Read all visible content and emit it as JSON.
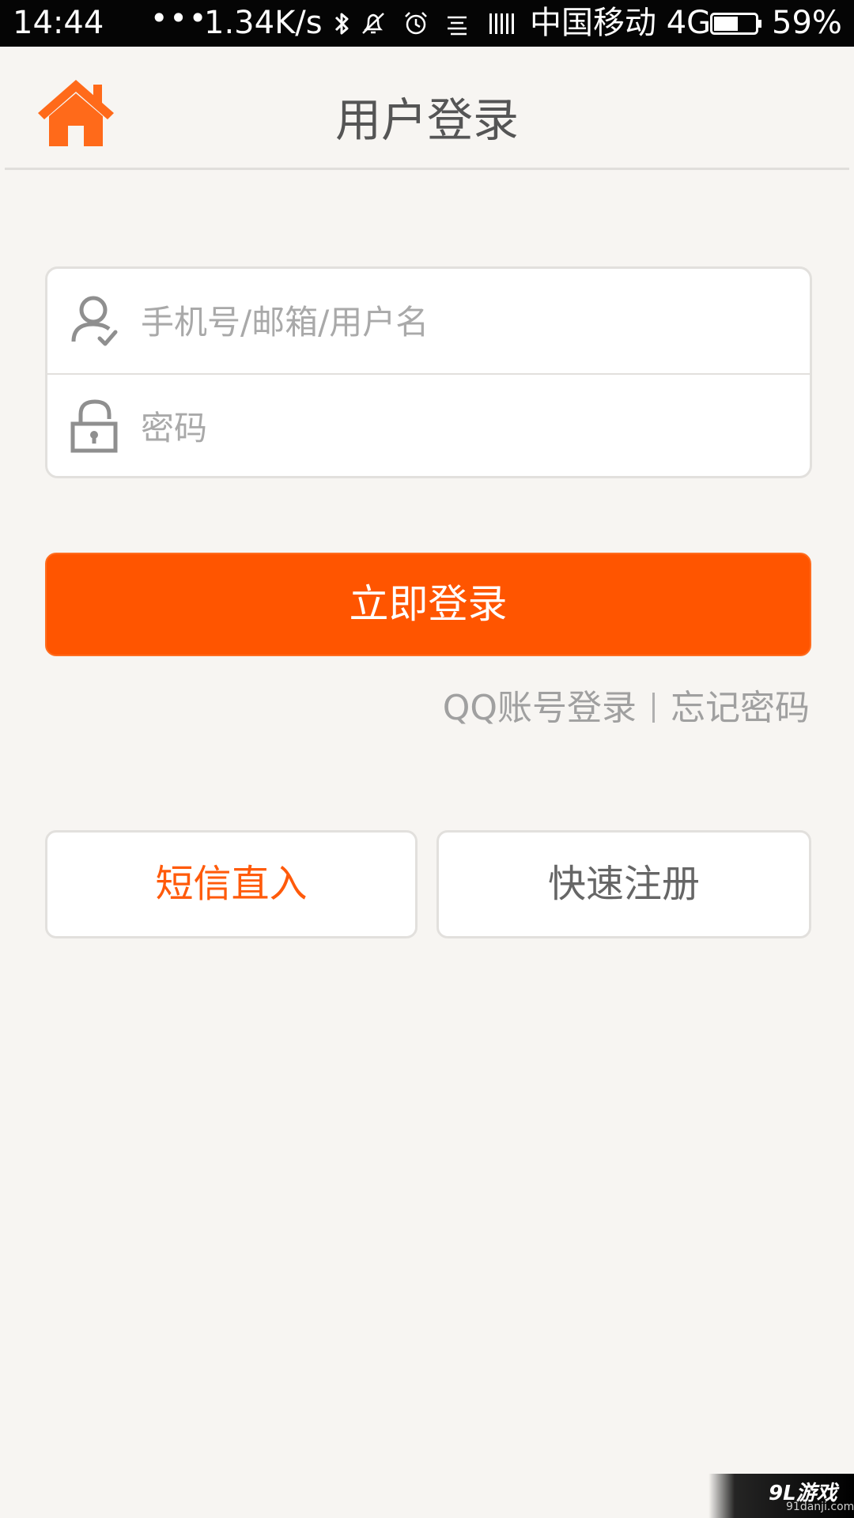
{
  "status_bar": {
    "time": "14:44",
    "dots": "•••",
    "net_speed": "1.34K/s",
    "carrier": "中国移动 4G",
    "battery_percent": "59%",
    "icons": [
      "bluetooth-icon",
      "vibrate-off-icon",
      "alarm-icon",
      "notification-lines-icon",
      "signal-bars-icon",
      "battery-icon"
    ]
  },
  "header": {
    "title": "用户登录",
    "home_icon": "home-icon"
  },
  "login_form": {
    "username_placeholder": "手机号/邮箱/用户名",
    "username_value": "",
    "password_placeholder": "密码",
    "password_value": "",
    "user_icon": "user-icon",
    "lock_icon": "lock-icon"
  },
  "login_button": {
    "label": "立即登录"
  },
  "links": {
    "qq_login": "QQ账号登录",
    "forgot_password": "忘记密码"
  },
  "actions": {
    "sms_login": "短信直入",
    "quick_register": "快速注册"
  },
  "watermark": {
    "logo": "9L游戏",
    "url": "91danji.com"
  },
  "colors": {
    "accent": "#ff5500",
    "background": "#f7f5f2",
    "status_bar": "#050505",
    "sms_text": "#ff5a0a"
  }
}
